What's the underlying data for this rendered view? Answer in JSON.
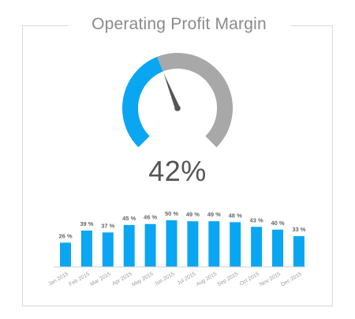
{
  "header": {
    "title": "Operating Profit Margin"
  },
  "kpi": {
    "value_label": "42%"
  },
  "colors": {
    "accent": "#0aa6f2",
    "track": "#a8a8a8",
    "needle": "#555555",
    "label": "#666666",
    "tick": "#9a9a9a",
    "axis": "#cfcfcf"
  },
  "chart_data": [
    {
      "type": "gauge",
      "value": 42,
      "value_label": "42%",
      "min": 0,
      "max": 100,
      "title": "Operating Profit Margin"
    },
    {
      "type": "bar",
      "categories": [
        "Jan 2015",
        "Feb 2015",
        "Mar 2015",
        "Apr 2015",
        "May 2015",
        "Jun 2015",
        "Jul 2015",
        "Aug 2015",
        "Sep 2015",
        "Oct 2015",
        "Nov 2015",
        "Dec 2015"
      ],
      "values": [
        26,
        39,
        37,
        45,
        46,
        50,
        49,
        49,
        48,
        43,
        40,
        33
      ],
      "data_labels": [
        "26 %",
        "39 %",
        "37 %",
        "45 %",
        "46 %",
        "50 %",
        "49 %",
        "49 %",
        "48 %",
        "43 %",
        "40 %",
        "33 %"
      ],
      "ylim": [
        0,
        50
      ],
      "grid": false,
      "xlabel": "",
      "ylabel": ""
    }
  ]
}
